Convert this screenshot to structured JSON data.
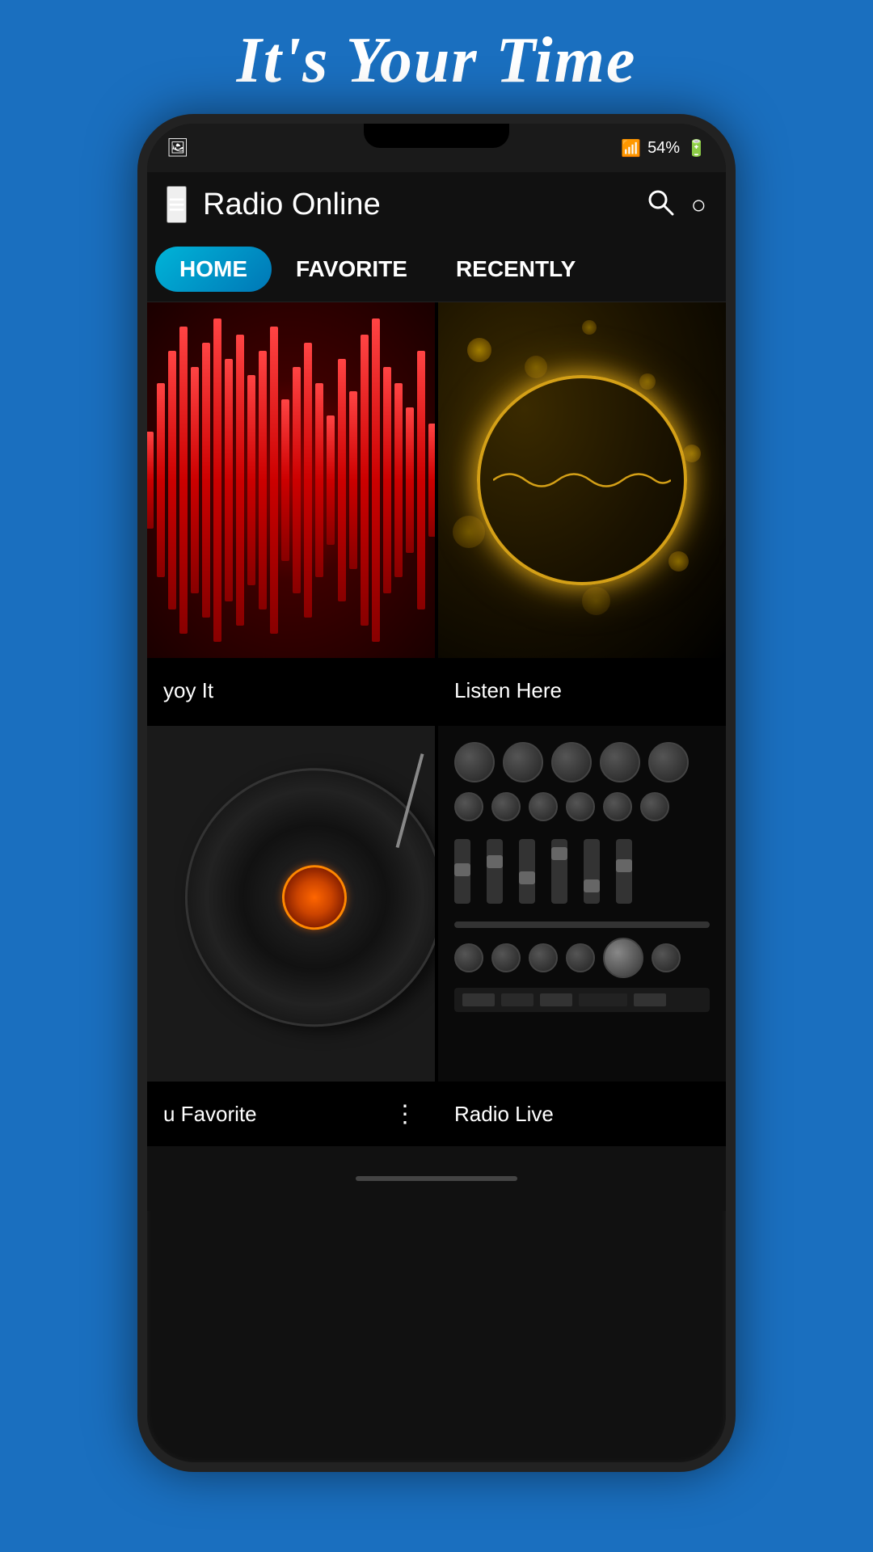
{
  "page": {
    "title": "It's Your Time",
    "background_color": "#1a6fbf"
  },
  "header": {
    "app_title": "Radio Online",
    "menu_label": "≡",
    "search_icon": "search",
    "more_icon": "more"
  },
  "tabs": [
    {
      "id": "home",
      "label": "HOME",
      "active": true
    },
    {
      "id": "favorite",
      "label": "FAVORITE",
      "active": false
    },
    {
      "id": "recent",
      "label": "RECENTLY",
      "active": false
    }
  ],
  "status_bar": {
    "battery": "54%",
    "signal": "▲▲▲▲"
  },
  "grid_items": [
    {
      "id": "card1",
      "label": "yoy It",
      "full_label": "Enjoy It",
      "type": "red-waveform",
      "has_more": false
    },
    {
      "id": "card2",
      "label": "Listen Here",
      "type": "gold-bokeh",
      "has_more": false
    },
    {
      "id": "card3",
      "label": "u Favorite",
      "full_label": "Your Favorite",
      "type": "vinyl",
      "has_more": true
    },
    {
      "id": "card4",
      "label": "Radio Live",
      "type": "dj-mixer",
      "has_more": false
    }
  ]
}
